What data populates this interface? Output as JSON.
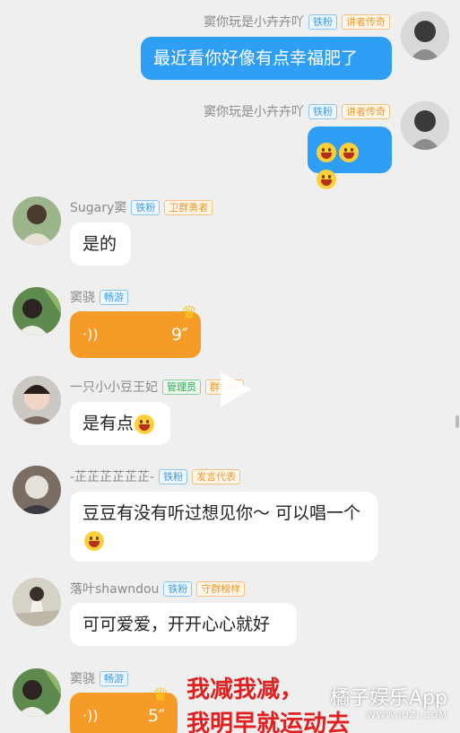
{
  "badges": {
    "iron_fan": "铁粉",
    "lecturer": "讲者传奇",
    "guard": "卫群勇者",
    "fluent": "畅游",
    "admin": "管理员",
    "model": "群榜样",
    "speaker": "发言代表",
    "guard_model": "守群榜样"
  },
  "messages": [
    {
      "sender": "窦你玩是小卉卉吖",
      "text": "最近看你好像有点幸福肥了"
    },
    {
      "sender": "窦你玩是小卉卉吖",
      "emoji": "laughing-emoji x3"
    },
    {
      "sender": "Sugary窦",
      "text": "是的"
    },
    {
      "sender": "窦骁",
      "voice_duration": "9″"
    },
    {
      "sender": "一只小小豆王妃",
      "text": "是有点"
    },
    {
      "sender": "-芷芷芷芷芷芷-",
      "text": "豆豆有没有听过想见你～ 可以唱一个"
    },
    {
      "sender": "落叶shawndou",
      "text": "可可爱爱，开开心心就好"
    },
    {
      "sender": "窦骁",
      "voice_duration": "5″"
    }
  ],
  "overlay_text": {
    "line1": "我减我减，",
    "line2": "我明早就运动去"
  },
  "watermark": {
    "brand": "橘子娱乐App",
    "url": "WWW.JUZI.COM"
  }
}
